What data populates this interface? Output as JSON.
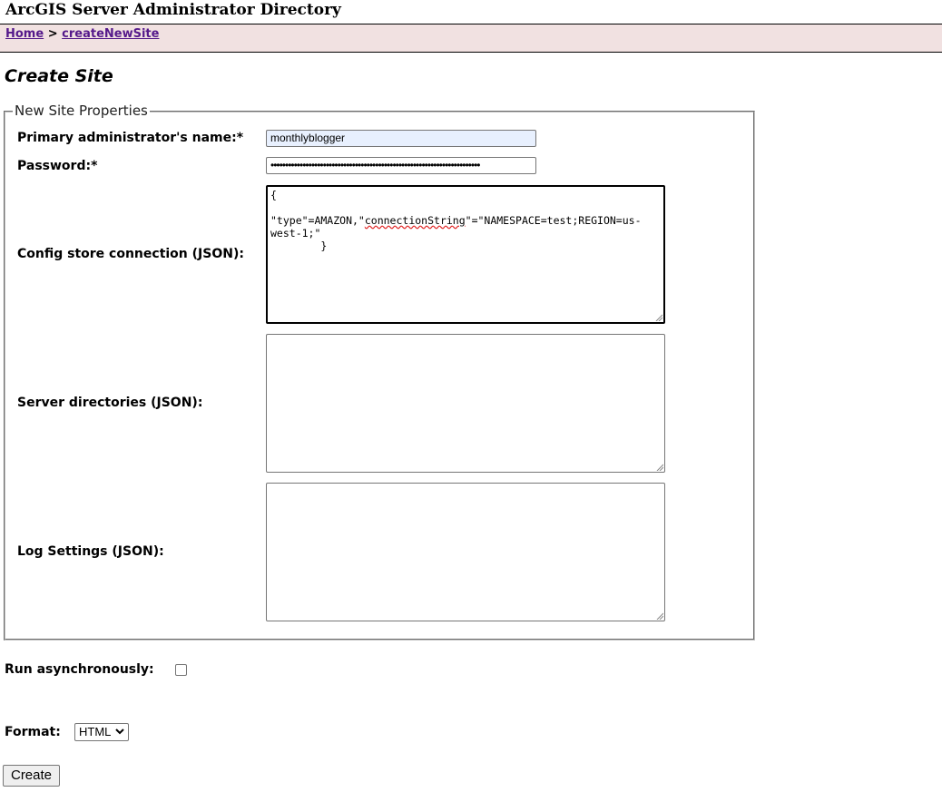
{
  "header": {
    "title": "ArcGIS Server Administrator Directory"
  },
  "breadcrumb": {
    "home": "Home",
    "separator": ">",
    "current": "createNewSite"
  },
  "page": {
    "title": "Create Site"
  },
  "form": {
    "legend": "New Site Properties",
    "admin_name_label": "Primary administrator's name:*",
    "admin_name_value": "monthlyblogger",
    "password_label": "Password:*",
    "password_value": "••••••••••••••••••••••••••••••••••••••••••••••••••••••••••••••••••••••••",
    "config_store_label": "Config store connection (JSON):",
    "config_store_line1": "{",
    "config_store_line2a": "\"type\"=AMAZON,\"",
    "config_store_line2b": "connectionString",
    "config_store_line2c": "\"=\"NAMESPACE=test;REGION=us-west-1;\"",
    "config_store_line3": "        }",
    "server_dirs_label": "Server directories (JSON):",
    "server_dirs_value": "",
    "log_settings_label": "Log Settings (JSON):",
    "log_settings_value": ""
  },
  "options": {
    "run_async_label": "Run asynchronously:",
    "run_async_checked": false,
    "format_label": "Format:",
    "format_value": "HTML"
  },
  "actions": {
    "create_label": "Create"
  }
}
